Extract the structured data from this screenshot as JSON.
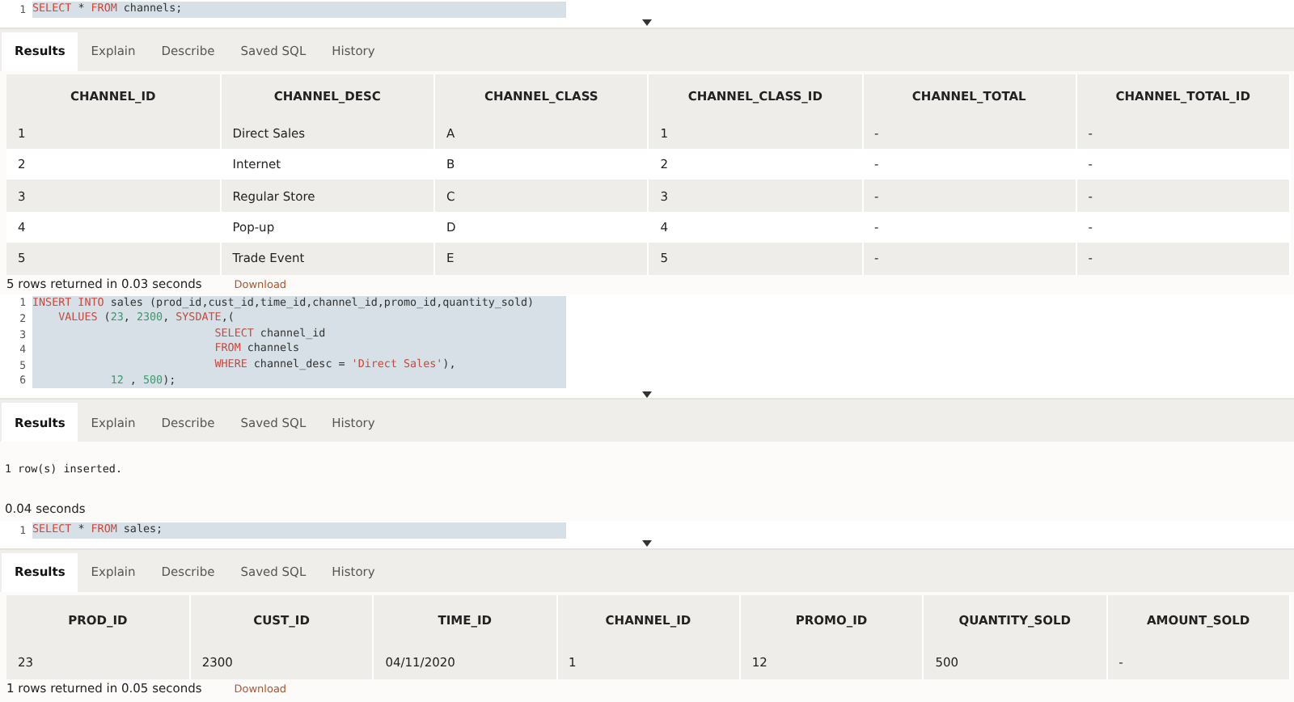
{
  "worksheets": [
    {
      "editor": {
        "highlighted": true,
        "lines": [
          {
            "number": "1",
            "tokens": [
              {
                "kind": "keyword",
                "text": "SELECT"
              },
              {
                "kind": "plain",
                "text": " * "
              },
              {
                "kind": "keyword",
                "text": "FROM"
              },
              {
                "kind": "plain",
                "text": " channels;"
              }
            ]
          }
        ]
      },
      "tabs": [
        {
          "label": "Results",
          "selected": true
        },
        {
          "label": "Explain",
          "selected": false
        },
        {
          "label": "Describe",
          "selected": false
        },
        {
          "label": "Saved SQL",
          "selected": false
        },
        {
          "label": "History",
          "selected": false
        }
      ],
      "result": {
        "kind": "table",
        "columns": [
          "CHANNEL_ID",
          "CHANNEL_DESC",
          "CHANNEL_CLASS",
          "CHANNEL_CLASS_ID",
          "CHANNEL_TOTAL",
          "CHANNEL_TOTAL_ID"
        ],
        "rows": [
          [
            "1",
            "Direct Sales",
            "A",
            "1",
            "-",
            "-"
          ],
          [
            "2",
            "Internet",
            "B",
            "2",
            "-",
            "-"
          ],
          [
            "3",
            "Regular Store",
            "C",
            "3",
            "-",
            "-"
          ],
          [
            "4",
            "Pop-up",
            "D",
            "4",
            "-",
            "-"
          ],
          [
            "5",
            "Trade Event",
            "E",
            "5",
            "-",
            "-"
          ]
        ],
        "summary": "5 rows returned in 0.03 seconds",
        "download": "Download"
      }
    },
    {
      "editor": {
        "highlighted": true,
        "lines": [
          {
            "number": "1",
            "tokens": [
              {
                "kind": "keyword",
                "text": "INSERT INTO"
              },
              {
                "kind": "plain",
                "text": " sales (prod_id,cust_id,time_id,channel_id,promo_id,quantity_sold)"
              }
            ]
          },
          {
            "number": "2",
            "tokens": [
              {
                "kind": "keyword",
                "text": "    VALUES"
              },
              {
                "kind": "plain",
                "text": " ("
              },
              {
                "kind": "number",
                "text": "23"
              },
              {
                "kind": "plain",
                "text": ", "
              },
              {
                "kind": "number",
                "text": "2300"
              },
              {
                "kind": "plain",
                "text": ", "
              },
              {
                "kind": "keyword",
                "text": "SYSDATE"
              },
              {
                "kind": "plain",
                "text": ",("
              }
            ]
          },
          {
            "number": "3",
            "tokens": [
              {
                "kind": "keyword",
                "text": "                            SELECT"
              },
              {
                "kind": "plain",
                "text": " channel_id"
              }
            ]
          },
          {
            "number": "4",
            "tokens": [
              {
                "kind": "keyword",
                "text": "                            FROM"
              },
              {
                "kind": "plain",
                "text": " channels"
              }
            ]
          },
          {
            "number": "5",
            "tokens": [
              {
                "kind": "keyword",
                "text": "                            WHERE"
              },
              {
                "kind": "plain",
                "text": " channel_desc = "
              },
              {
                "kind": "string",
                "text": "'Direct Sales'"
              },
              {
                "kind": "plain",
                "text": "),"
              }
            ]
          },
          {
            "number": "6",
            "tokens": [
              {
                "kind": "number",
                "text": "            12"
              },
              {
                "kind": "plain",
                "text": " , "
              },
              {
                "kind": "number",
                "text": "500"
              },
              {
                "kind": "plain",
                "text": ");"
              }
            ]
          }
        ]
      },
      "tabs": [
        {
          "label": "Results",
          "selected": true
        },
        {
          "label": "Explain",
          "selected": false
        },
        {
          "label": "Describe",
          "selected": false
        },
        {
          "label": "Saved SQL",
          "selected": false
        },
        {
          "label": "History",
          "selected": false
        }
      ],
      "result": {
        "kind": "message",
        "message": "1 row(s) inserted.",
        "summary": "0.04 seconds"
      }
    },
    {
      "editor": {
        "highlighted": true,
        "lines": [
          {
            "number": "1",
            "tokens": [
              {
                "kind": "keyword",
                "text": "SELECT"
              },
              {
                "kind": "plain",
                "text": " * "
              },
              {
                "kind": "keyword",
                "text": "FROM"
              },
              {
                "kind": "plain",
                "text": " sales;"
              }
            ]
          }
        ]
      },
      "tabs": [
        {
          "label": "Results",
          "selected": true
        },
        {
          "label": "Explain",
          "selected": false
        },
        {
          "label": "Describe",
          "selected": false
        },
        {
          "label": "Saved SQL",
          "selected": false
        },
        {
          "label": "History",
          "selected": false
        }
      ],
      "result": {
        "kind": "table",
        "columns": [
          "PROD_ID",
          "CUST_ID",
          "TIME_ID",
          "CHANNEL_ID",
          "PROMO_ID",
          "QUANTITY_SOLD",
          "AMOUNT_SOLD"
        ],
        "rows": [
          [
            "23",
            "2300",
            "04/11/2020",
            "1",
            "12",
            "500",
            "-"
          ]
        ],
        "summary": "1 rows returned in 0.05 seconds",
        "download": "Download"
      }
    }
  ]
}
